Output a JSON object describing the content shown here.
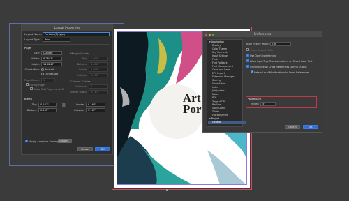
{
  "layout_dialog": {
    "title": "Layout Properties",
    "layout_name_label": "Layout Name:",
    "layout_name_value": "Portfolio(1).lyjpg",
    "layout_type_label": "Layout Type:",
    "layout_type_value": "Print",
    "page_section": "Page",
    "size_label": "Size:",
    "size_value": "Custom",
    "width_label": "Width:",
    "width_value": "8.2847\"",
    "height_label": "Height:",
    "height_value": "11.6847\"",
    "orientation_label": "Orientation:",
    "portrait_label": "Portrait",
    "landscape_label": "Landscape",
    "page_count_label": "Page Count:",
    "page_count_value": "1",
    "facing_pages_label": "Facing Pages",
    "allow_odd_label": "Allow Odd Pages on Left",
    "margin_guides_section": "Margin Guides",
    "top_label": "Top:",
    "top_value": "1.000\"",
    "bottom_label": "Bottom:",
    "bottom_value": "1.000\"",
    "inside_label": "Inside:",
    "inside_value": "1.000\"",
    "outside_label": "Outside:",
    "outside_value": "1.000\"",
    "column_guides_section": "Column Guides",
    "columns_label": "Columns:",
    "columns_value": "1",
    "gutter_label": "Gutter Width:",
    "gutter_value": "0.167\"",
    "bleed_section": "Bleed",
    "bleed_top_label": "Top:",
    "bleed_top_value": "0.167\"",
    "bleed_bottom_label": "Bottom:",
    "bleed_bottom_value": "0.167\"",
    "bleed_inside_label": "Inside:",
    "bleed_inside_value": "0.167\"",
    "bleed_outside_label": "Outside:",
    "bleed_outside_value": "0.167\"",
    "adaptive_label": "Apply Adaptive Scaling",
    "options_button": "Options...",
    "cancel_button": "Cancel",
    "ok_button": "OK"
  },
  "document": {
    "title_line1": "Art",
    "title_line2": "Portfol"
  },
  "preferences": {
    "title": "Preferences",
    "sidebar": {
      "application_header": "Application",
      "items": [
        "Display",
        "Color Theme",
        "Key Shortcuts",
        "Input Settings",
        "Fonts",
        "Font Fallback",
        "Font Management",
        "Open and Save",
        "EPS Import",
        "Extension Manager",
        "Sharing",
        "Save Action",
        "Index",
        "Job Jackets",
        "Notes",
        "PDF",
        "Tagged PDF",
        "Redline",
        "Spell Check",
        "Tables",
        "Fraction/Price"
      ],
      "project_header": "Project",
      "selected_item": "General"
    },
    "auto_picture_label": "Auto Picture Import:",
    "auto_picture_value": "Off",
    "single_layout_label": "Single Layout Mode",
    "opentype_label": "Use OpenType Kerning",
    "allow_transform_label": "Allow OpenType Transformations on Mixed Color Text",
    "sync_label": "Synchronize All Cross References During Output",
    "retain_label": "Retain Local Modifications to Cross References",
    "pasteboard_section": "Pasteboard",
    "pasteboard_height_label": "Height:",
    "pasteboard_height_value": "5\"",
    "cancel_button": "Cancel",
    "ok_button": "OK"
  },
  "colors": {
    "accent_blue": "#2d6fd6",
    "selection_blue": "#3f5c86",
    "highlight_red": "#c0394b",
    "margin_purple": "#8a7be0"
  }
}
